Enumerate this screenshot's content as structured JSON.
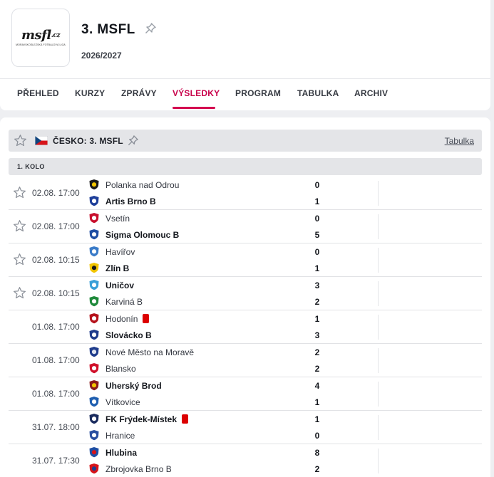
{
  "header": {
    "logo_main": "msfl",
    "logo_suffix": ".cz",
    "logo_sub": "MORAVSKOSLEZSKÁ FOTBALOVÁ LIGA",
    "league_name": "3. MSFL",
    "season": "2026/2027"
  },
  "tabs": [
    "PŘEHLED",
    "KURZY",
    "ZPRÁVY",
    "VÝSLEDKY",
    "PROGRAM",
    "TABULKA",
    "ARCHIV"
  ],
  "active_tab": "VÝSLEDKY",
  "league_bar": {
    "country_league": "ČESKO: 3. MSFL",
    "table_link": "Tabulka"
  },
  "round_label": "1. KOLO",
  "colors": {
    "accent": "#d4024f",
    "red_card": "#dc0000"
  },
  "matches": [
    {
      "time": "02.08. 17:00",
      "starred": true,
      "home": "Polanka nad Odrou",
      "away": "Artis Brno B",
      "home_score": "0",
      "away_score": "1",
      "winner": "away",
      "home_red_card": false
    },
    {
      "time": "02.08. 17:00",
      "starred": true,
      "home": "Vsetín",
      "away": "Sigma Olomouc B",
      "home_score": "0",
      "away_score": "5",
      "winner": "away",
      "home_red_card": false
    },
    {
      "time": "02.08. 10:15",
      "starred": true,
      "home": "Havířov",
      "away": "Zlín B",
      "home_score": "0",
      "away_score": "1",
      "winner": "away",
      "home_red_card": false
    },
    {
      "time": "02.08. 10:15",
      "starred": true,
      "home": "Uničov",
      "away": "Karviná B",
      "home_score": "3",
      "away_score": "2",
      "winner": "home",
      "home_red_card": false
    },
    {
      "time": "01.08. 17:00",
      "starred": false,
      "home": "Hodonín",
      "away": "Slovácko B",
      "home_score": "1",
      "away_score": "3",
      "winner": "away",
      "home_red_card": true
    },
    {
      "time": "01.08. 17:00",
      "starred": false,
      "home": "Nové Město na Moravě",
      "away": "Blansko",
      "home_score": "2",
      "away_score": "2",
      "winner": "none",
      "home_red_card": false
    },
    {
      "time": "01.08. 17:00",
      "starred": false,
      "home": "Uherský Brod",
      "away": "Vítkovice",
      "home_score": "4",
      "away_score": "1",
      "winner": "home",
      "home_red_card": false
    },
    {
      "time": "31.07. 18:00",
      "starred": false,
      "home": "FK Frýdek-Místek",
      "away": "Hranice",
      "home_score": "1",
      "away_score": "0",
      "winner": "home",
      "home_red_card": true
    },
    {
      "time": "31.07. 17:30",
      "starred": false,
      "home": "Hlubina",
      "away": "Zbrojovka Brno B",
      "home_score": "8",
      "away_score": "2",
      "winner": "home",
      "home_red_card": false
    }
  ]
}
